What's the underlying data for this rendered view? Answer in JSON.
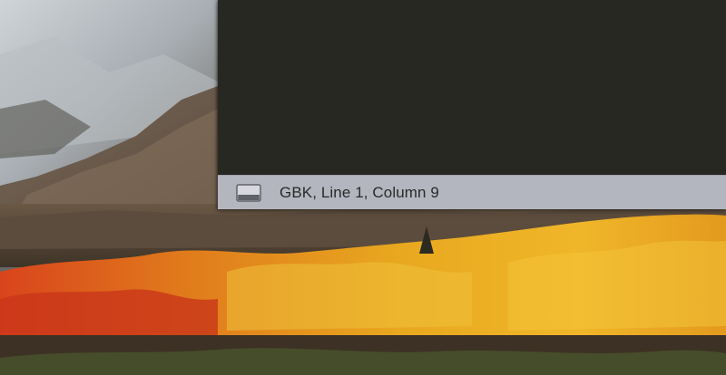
{
  "status_bar": {
    "panel_toggle_icon": "panel-toggle-icon",
    "status_text": "GBK, Line 1, Column 9"
  },
  "editor": {
    "background_color": "#272822"
  },
  "wallpaper": {
    "icon": "mountain-autumn-wallpaper"
  }
}
